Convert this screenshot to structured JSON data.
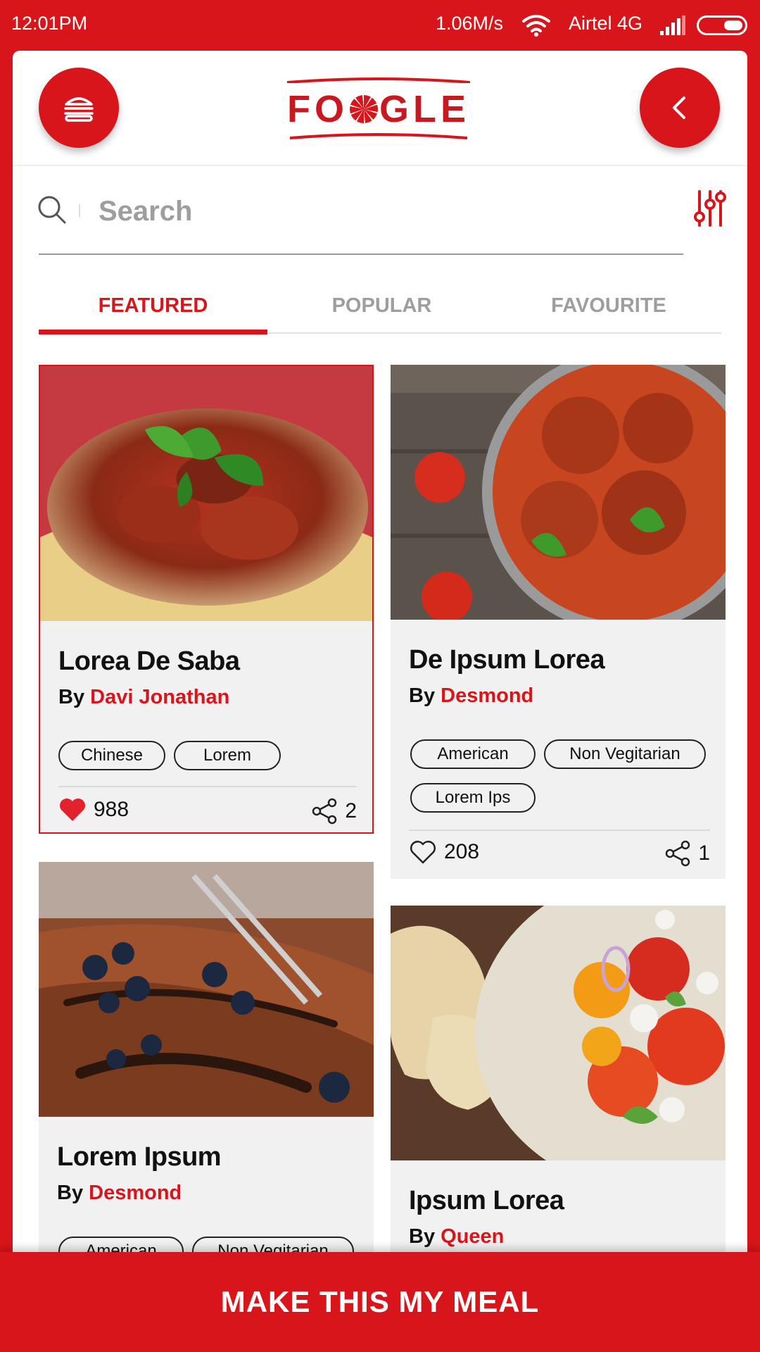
{
  "status_bar": {
    "time": "12:01PM",
    "network_speed": "1.06M/s",
    "carrier": "Airtel 4G"
  },
  "header": {
    "logo_text_1": "FO",
    "logo_text_2": "GLE",
    "menu_icon": "burger-icon",
    "back_icon": "chevron-left-icon"
  },
  "search": {
    "placeholder": "Search",
    "value": "",
    "filter_icon": "sliders-icon"
  },
  "tabs": [
    {
      "label": "FEATURED",
      "active": true
    },
    {
      "label": "POPULAR",
      "active": false
    },
    {
      "label": "FAVOURITE",
      "active": false
    }
  ],
  "cards": [
    {
      "title": "Lorea De Saba",
      "by": "By",
      "author": "Davi Jonathan",
      "tags": [
        "Chinese",
        "Lorem"
      ],
      "likes": "988",
      "liked": true,
      "shares": "2",
      "image": "spaghetti bolognese with basil"
    },
    {
      "title": "De Ipsum Lorea",
      "by": "By",
      "author": "Desmond",
      "tags": [
        "American",
        "Non Vegitarian",
        "Lorem Ips"
      ],
      "likes": "208",
      "liked": false,
      "shares": "1",
      "image": "meatballs in tomato sauce"
    },
    {
      "title": "Lorem Ipsum",
      "by": "By",
      "author": "Desmond",
      "tags": [
        "American",
        "Non Vegitarian"
      ],
      "image": "crepes with blueberries and chocolate"
    },
    {
      "title": "Ipsum Lorea",
      "by": "By",
      "author": "Queen",
      "image": "bread and tomato salad"
    }
  ],
  "cta": {
    "label": "MAKE THIS MY MEAL"
  },
  "colors": {
    "brand": "#d7151b",
    "card_bg": "#f1f1f1"
  }
}
